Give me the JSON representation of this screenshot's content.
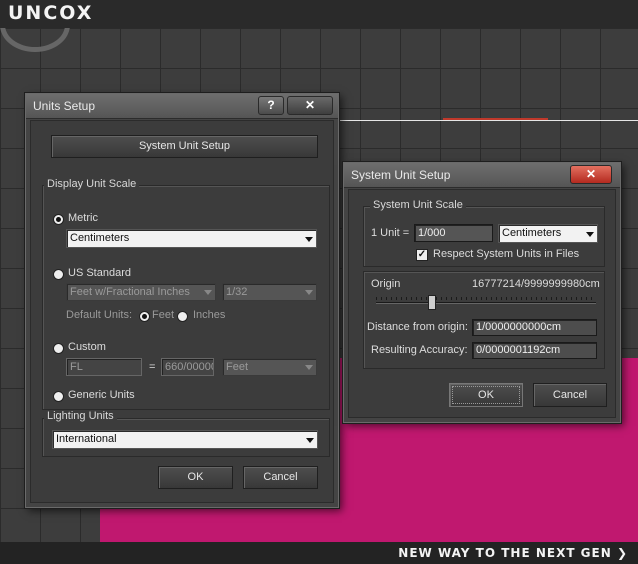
{
  "brand": {
    "logo": "UNCOX",
    "tagline": "NEW WAY TO THE NEXT GEN ❯"
  },
  "units_setup": {
    "title": "Units Setup",
    "help_label": "?",
    "close_label": "✕",
    "system_unit_setup_button": "System Unit Setup",
    "display_group_title": "Display Unit Scale",
    "metric_label": "Metric",
    "metric_value": "Centimeters",
    "us_standard_label": "US Standard",
    "us_standard_value": "Feet w/Fractional Inches",
    "fraction_value": "1/32",
    "default_units_label": "Default Units:",
    "feet_label": "Feet",
    "inches_label": "Inches",
    "custom_label": "Custom",
    "custom_name_value": "FL",
    "custom_equals": "=",
    "custom_amount_value": "660/00000",
    "custom_units_value": "Feet",
    "generic_units_label": "Generic Units",
    "lighting_group_title": "Lighting Units",
    "lighting_value": "International",
    "ok_label": "OK",
    "cancel_label": "Cancel",
    "selected_unit_scale": "Metric",
    "selected_default_unit": "Feet"
  },
  "system_unit_setup": {
    "title": "System Unit Setup",
    "close_label": "✕",
    "scale_group_title": "System Unit Scale",
    "unit_label": "1 Unit =",
    "unit_value": "1/000",
    "unit_type_value": "Centimeters",
    "respect_label": "Respect System Units in Files",
    "respect_checked": true,
    "origin_label": "Origin",
    "origin_value": "16777214/9999999980cm",
    "origin_slider_level": 0.25,
    "distance_label": "Distance from origin:",
    "distance_value": "1/0000000000cm",
    "accuracy_label": "Resulting Accuracy:",
    "accuracy_value": "0/0000001192cm",
    "ok_label": "OK",
    "cancel_label": "Cancel"
  },
  "colors": {
    "viewport_object": "#c0186f",
    "close_button": "#b42a1f"
  }
}
